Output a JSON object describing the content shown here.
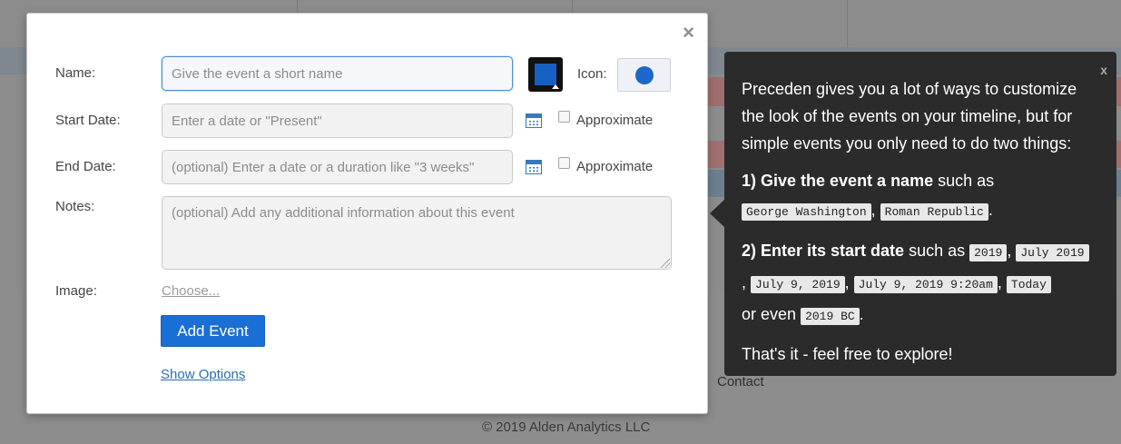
{
  "background": {
    "contact_link": "Contact",
    "footer": "© 2019 Alden Analytics LLC"
  },
  "modal": {
    "close": "×",
    "name_label": "Name:",
    "name_placeholder": "Give the event a short name",
    "color_accent": "#1660c4",
    "icon_label": "Icon:",
    "icon_color": "#1c67c9",
    "start_label": "Start Date:",
    "start_placeholder": "Enter a date or \"Present\"",
    "end_label": "End Date:",
    "end_placeholder": "(optional) Enter a date or a duration like \"3 weeks\"",
    "approximate": "Approximate",
    "notes_label": "Notes:",
    "notes_placeholder": "(optional) Add any additional information about this event",
    "image_label": "Image:",
    "choose": "Choose...",
    "add_event": "Add Event",
    "show_options": "Show Options"
  },
  "tooltip": {
    "close": "x",
    "intro": "Preceden gives you a lot of ways to customize the look of the events on your timeline, but for simple events you only need to do two things:",
    "step1_bold": "1) Give the event a name",
    "step1_rest": " such as",
    "step1_examples": [
      "George Washington",
      "Roman Republic"
    ],
    "step2_bold": "2) Enter its start date",
    "step2_rest": " such as",
    "step2_examples": [
      "2019",
      "July 2019",
      "July 9, 2019",
      "July 9, 2019 9:20am",
      "Today"
    ],
    "or_even": "or even",
    "step2_last": "2019 BC",
    "outro": "That's it - feel free to explore!"
  }
}
